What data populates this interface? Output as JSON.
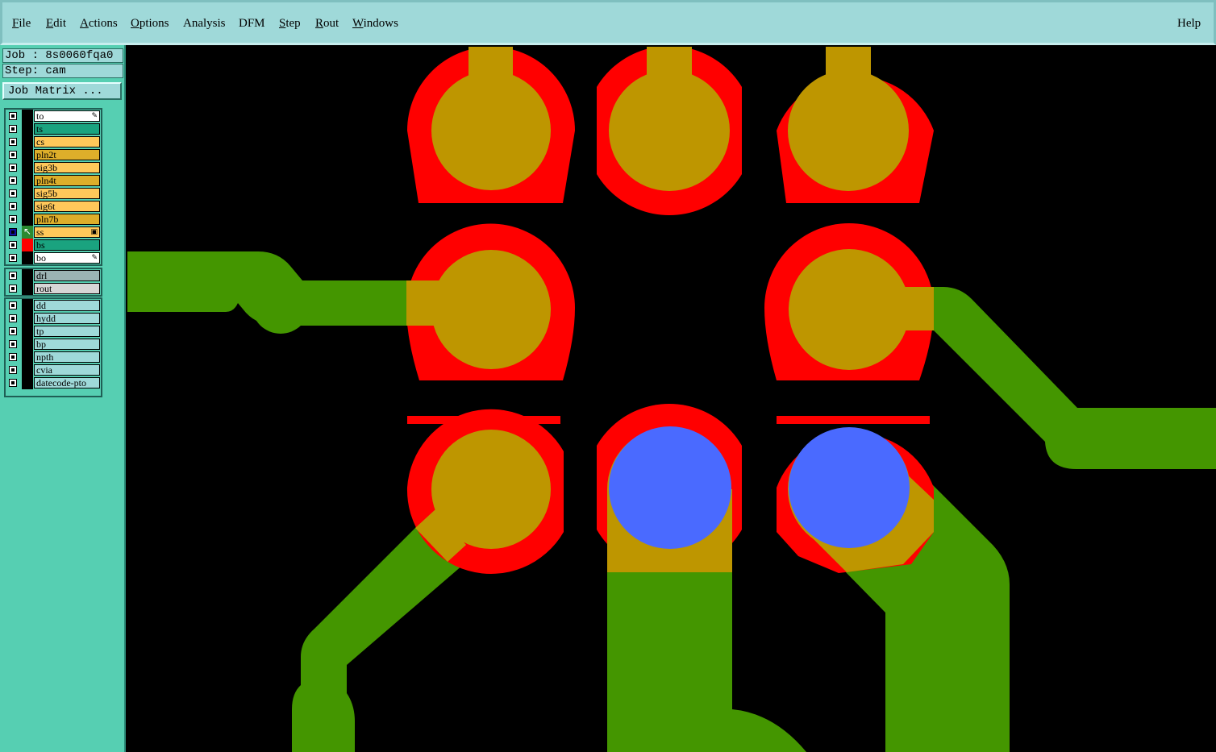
{
  "menubar": {
    "items": [
      {
        "label": "File",
        "underline": "F",
        "rest": "ile"
      },
      {
        "label": "Edit",
        "underline": "E",
        "rest": "dit"
      },
      {
        "label": "Actions",
        "underline": "A",
        "rest": "ctions"
      },
      {
        "label": "Options",
        "underline": "O",
        "rest": "ptions"
      },
      {
        "label": "Analysis",
        "underline": "",
        "rest": "Analysis"
      },
      {
        "label": "DFM",
        "underline": "",
        "rest": "DFM"
      },
      {
        "label": "Step",
        "underline": "S",
        "rest": "tep"
      },
      {
        "label": "Rout",
        "underline": "R",
        "rest": "out"
      },
      {
        "label": "Windows",
        "underline": "W",
        "rest": "indows"
      }
    ],
    "help": "Help"
  },
  "job": {
    "job_label": "Job : 8s0060fqa0",
    "step_label": "Step: cam",
    "matrix_button": "Job Matrix ..."
  },
  "layers": {
    "board": [
      {
        "name": "to",
        "color": "#ffffff",
        "mark": "✎"
      },
      {
        "name": "ts",
        "color": "#1aa37f"
      },
      {
        "name": "cs",
        "color": "#ffc85a"
      },
      {
        "name": "pln2t",
        "color": "#ddae2a"
      },
      {
        "name": "sig3b",
        "color": "#ffc85a"
      },
      {
        "name": "pln4t",
        "color": "#ddae2a"
      },
      {
        "name": "sig5b",
        "color": "#ffc85a"
      },
      {
        "name": "sig6t",
        "color": "#ffc85a"
      },
      {
        "name": "pln7b",
        "color": "#ddae2a"
      },
      {
        "name": "ss",
        "color": "#ffc85a",
        "mark": "▣",
        "active": true
      },
      {
        "name": "bs",
        "color": "#1aa37f",
        "display": "red"
      },
      {
        "name": "bo",
        "color": "#ffffff",
        "mark": "✎"
      }
    ],
    "drill": [
      {
        "name": "drl",
        "color": "#9bb3b3"
      },
      {
        "name": "rout",
        "color": "#d6d6d6"
      }
    ],
    "misc": [
      {
        "name": "dd",
        "color": "#9fd9d9"
      },
      {
        "name": "hydd",
        "color": "#9fd9d9"
      },
      {
        "name": "tp",
        "color": "#9fd9d9"
      },
      {
        "name": "bp",
        "color": "#9fd9d9"
      },
      {
        "name": "npth",
        "color": "#9fd9d9"
      },
      {
        "name": "cvia",
        "color": "#9fd9d9"
      },
      {
        "name": "datecode-pto",
        "color": "#9fd9d9"
      }
    ]
  },
  "colors": {
    "pad_ring": "#ff0000",
    "pad_copper": "#be9600",
    "trace": "#449600",
    "drill_hole": "#4a6aff",
    "background": "#000000"
  }
}
